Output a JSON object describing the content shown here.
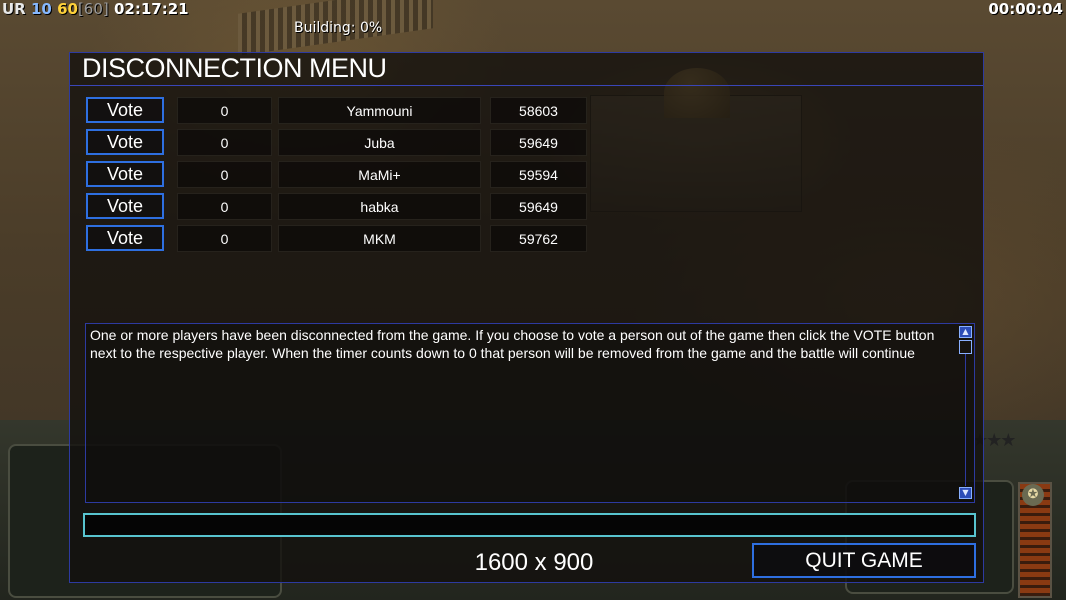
{
  "hud": {
    "ur": "UR",
    "level": "10",
    "fps": "60",
    "fps_max": "[60]",
    "game_clock": "02:17:21",
    "match_timer": "00:00:04",
    "building_status": "Building: 0%"
  },
  "dialog": {
    "title": "DISCONNECTION MENU",
    "vote_label": "Vote",
    "players": [
      {
        "votes": "0",
        "name": "Yammouni",
        "ping": "58603"
      },
      {
        "votes": "0",
        "name": "Juba",
        "ping": "59649"
      },
      {
        "votes": "0",
        "name": "MaMi+",
        "ping": "59594"
      },
      {
        "votes": "0",
        "name": "habka",
        "ping": "59649"
      },
      {
        "votes": "0",
        "name": "MKM",
        "ping": "59762"
      }
    ],
    "message": "One or more players have been disconnected from the game. If you choose to vote a person out of the game then click the VOTE button next to the respective player. When the timer counts down to 0 that person will be removed from the game and the battle will continue",
    "chat_value": "",
    "resolution": "1600 x 900",
    "quit_label": "QUIT GAME"
  },
  "colors": {
    "accent_blue": "#2e6fe0",
    "input_cyan": "#58c4cf",
    "fps_yellow": "#ffd23a",
    "level_blue": "#86b8ff"
  }
}
